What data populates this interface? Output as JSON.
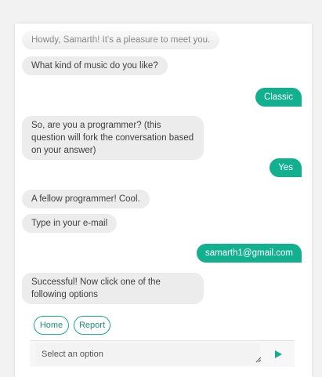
{
  "chat": {
    "messages": [
      {
        "from": "bot",
        "text": "Howdy, Samarth! It's a pleasure to meet you."
      },
      {
        "from": "bot",
        "text": "What kind of music do you like?"
      },
      {
        "from": "user",
        "text": "Classic"
      },
      {
        "from": "bot",
        "text": "So, are you a programmer? (this question will fork the conversation based on your answer)"
      },
      {
        "from": "user",
        "text": "Yes"
      },
      {
        "from": "bot",
        "text": "A fellow programmer! Cool."
      },
      {
        "from": "bot",
        "text": "Type in your e-mail"
      },
      {
        "from": "user",
        "text": "samarth1@gmail.com"
      },
      {
        "from": "bot",
        "text": "Successful! Now click one of the following options"
      }
    ],
    "options": [
      {
        "label": "Home"
      },
      {
        "label": "Report"
      }
    ],
    "input": {
      "placeholder": "Select an option"
    }
  },
  "colors": {
    "accent": "#13b08f",
    "bot_bubble": "#ececec",
    "background": "#f2f2f2"
  },
  "icons": {
    "send": "send-icon",
    "resize": "resize-grip-icon"
  }
}
